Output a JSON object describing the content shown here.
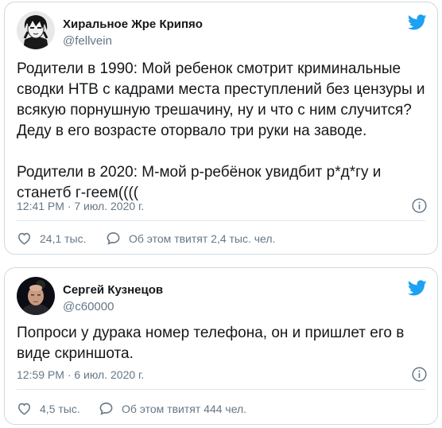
{
  "colors": {
    "twitter_blue": "#1da1f2",
    "secondary_text": "#657786",
    "border": "#cfd9de"
  },
  "tweets": [
    {
      "name": "Хиральное Жре Крипяо",
      "handle": "@fellvein",
      "avatar_icon": "anime-character-avatar",
      "text": "Родители в 1990: Мой ребенок смотрит криминальные сводки НТВ с кадрами места преступлений без цензуры и всякую порнушную трешачину, ну и что с ним случится? Деду в его возрасте оторвало три руки на заводе.\n\nРодители в 2020: М-мой р-ребёнок увидбит р*д*гу и станетб г-геем((((",
      "timestamp": "12:41 PM · 7 июл. 2020 г.",
      "likes": "24,1 тыс.",
      "discussion": "Об этом твитят 2,4 тыс. чел."
    },
    {
      "name": "Сергей Кузнецов",
      "handle": "@c60000",
      "avatar_icon": "man-photo-avatar",
      "text": "Попроси у дурака номер телефона, он и пришлет его в виде скриншота.",
      "timestamp": "12:59 PM · 6 июл. 2020 г.",
      "likes": "4,5 тыс.",
      "discussion": "Об этом твитят 444 чел."
    }
  ]
}
